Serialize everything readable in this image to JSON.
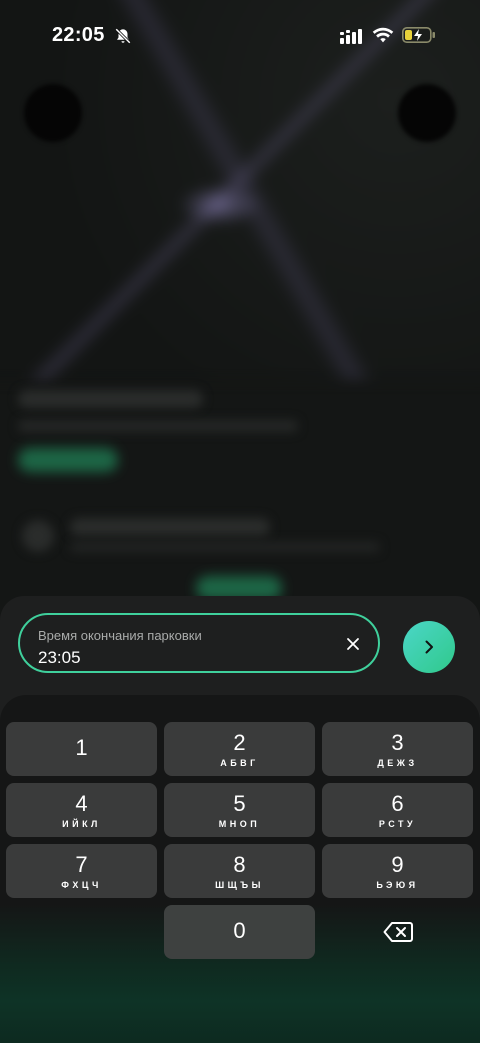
{
  "status_bar": {
    "time": "22:05",
    "icons": [
      "bell-slash-icon",
      "signal-icon",
      "wifi-icon",
      "battery-charging-icon"
    ]
  },
  "input": {
    "label": "Время окончания парковки",
    "value": "23:05",
    "clear_icon": "close-icon",
    "next_icon": "chevron-right-icon"
  },
  "keypad": {
    "keys": [
      {
        "digit": "1",
        "letters": ""
      },
      {
        "digit": "2",
        "letters": "АБВГ"
      },
      {
        "digit": "3",
        "letters": "ДЕЖЗ"
      },
      {
        "digit": "4",
        "letters": "ИЙКЛ"
      },
      {
        "digit": "5",
        "letters": "МНОП"
      },
      {
        "digit": "6",
        "letters": "РСТУ"
      },
      {
        "digit": "7",
        "letters": "ФХЦЧ"
      },
      {
        "digit": "8",
        "letters": "ШЩЪЫ"
      },
      {
        "digit": "9",
        "letters": "ЬЭЮЯ"
      },
      {
        "digit": "0",
        "letters": ""
      }
    ],
    "backspace_icon": "backspace-icon"
  },
  "colors": {
    "accent": "#3fd09c",
    "sheet": "#1e1f1f",
    "key": "#3a3b3b"
  }
}
